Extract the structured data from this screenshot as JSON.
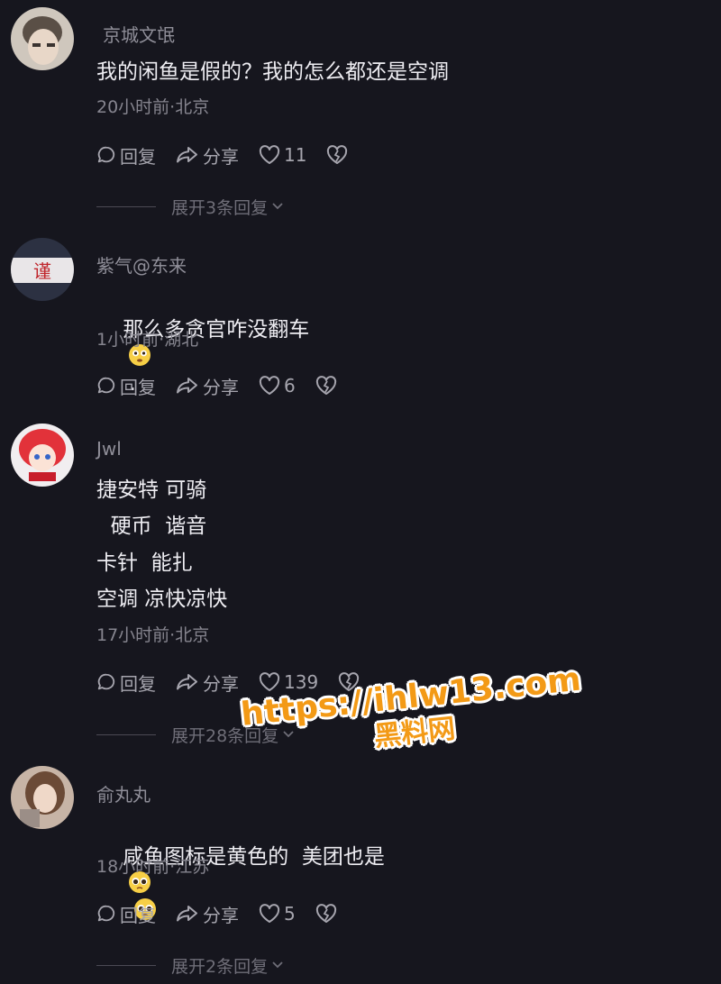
{
  "actions": {
    "reply_label": "回复",
    "share_label": "分享"
  },
  "comments": [
    {
      "username": "京城文氓",
      "lines": [
        "我的闲鱼是假的？我的怎么都还是空调"
      ],
      "meta": "20小时前·北京",
      "likes": "11",
      "expand_label": "展开3条回复"
    },
    {
      "username": "紫气@东来",
      "lines": [
        "那么多贪官咋没翻车",
        " ."
      ],
      "meta": "1小时前·湖北",
      "likes": "6",
      "avatar_text": "谨"
    },
    {
      "username": "Jwl",
      "lines": [
        "捷安特 可骑",
        "  硬币  谐音",
        "卡针  能扎",
        "空调 凉快凉快"
      ],
      "meta": "17小时前·北京",
      "likes": "139",
      "expand_label": "展开28条回复"
    },
    {
      "username": "俞丸丸",
      "lines": [
        "咸鱼图标是黄色的  美团也是"
      ],
      "meta": "18小时前·江苏",
      "likes": "5",
      "expand_label": "展开2条回复"
    }
  ],
  "watermark": {
    "url": "https://ihlw13.com",
    "name": "黑料网"
  },
  "colors": {
    "background": "#16161e",
    "text": "#eeedf2",
    "muted": "#86858f",
    "watermark": "#f39a16"
  },
  "icons": [
    "reply-icon",
    "share-icon",
    "heart-icon",
    "dislike-icon",
    "chevron-down-icon",
    "flushed-face-emoji",
    "pleading-face-emoji"
  ]
}
